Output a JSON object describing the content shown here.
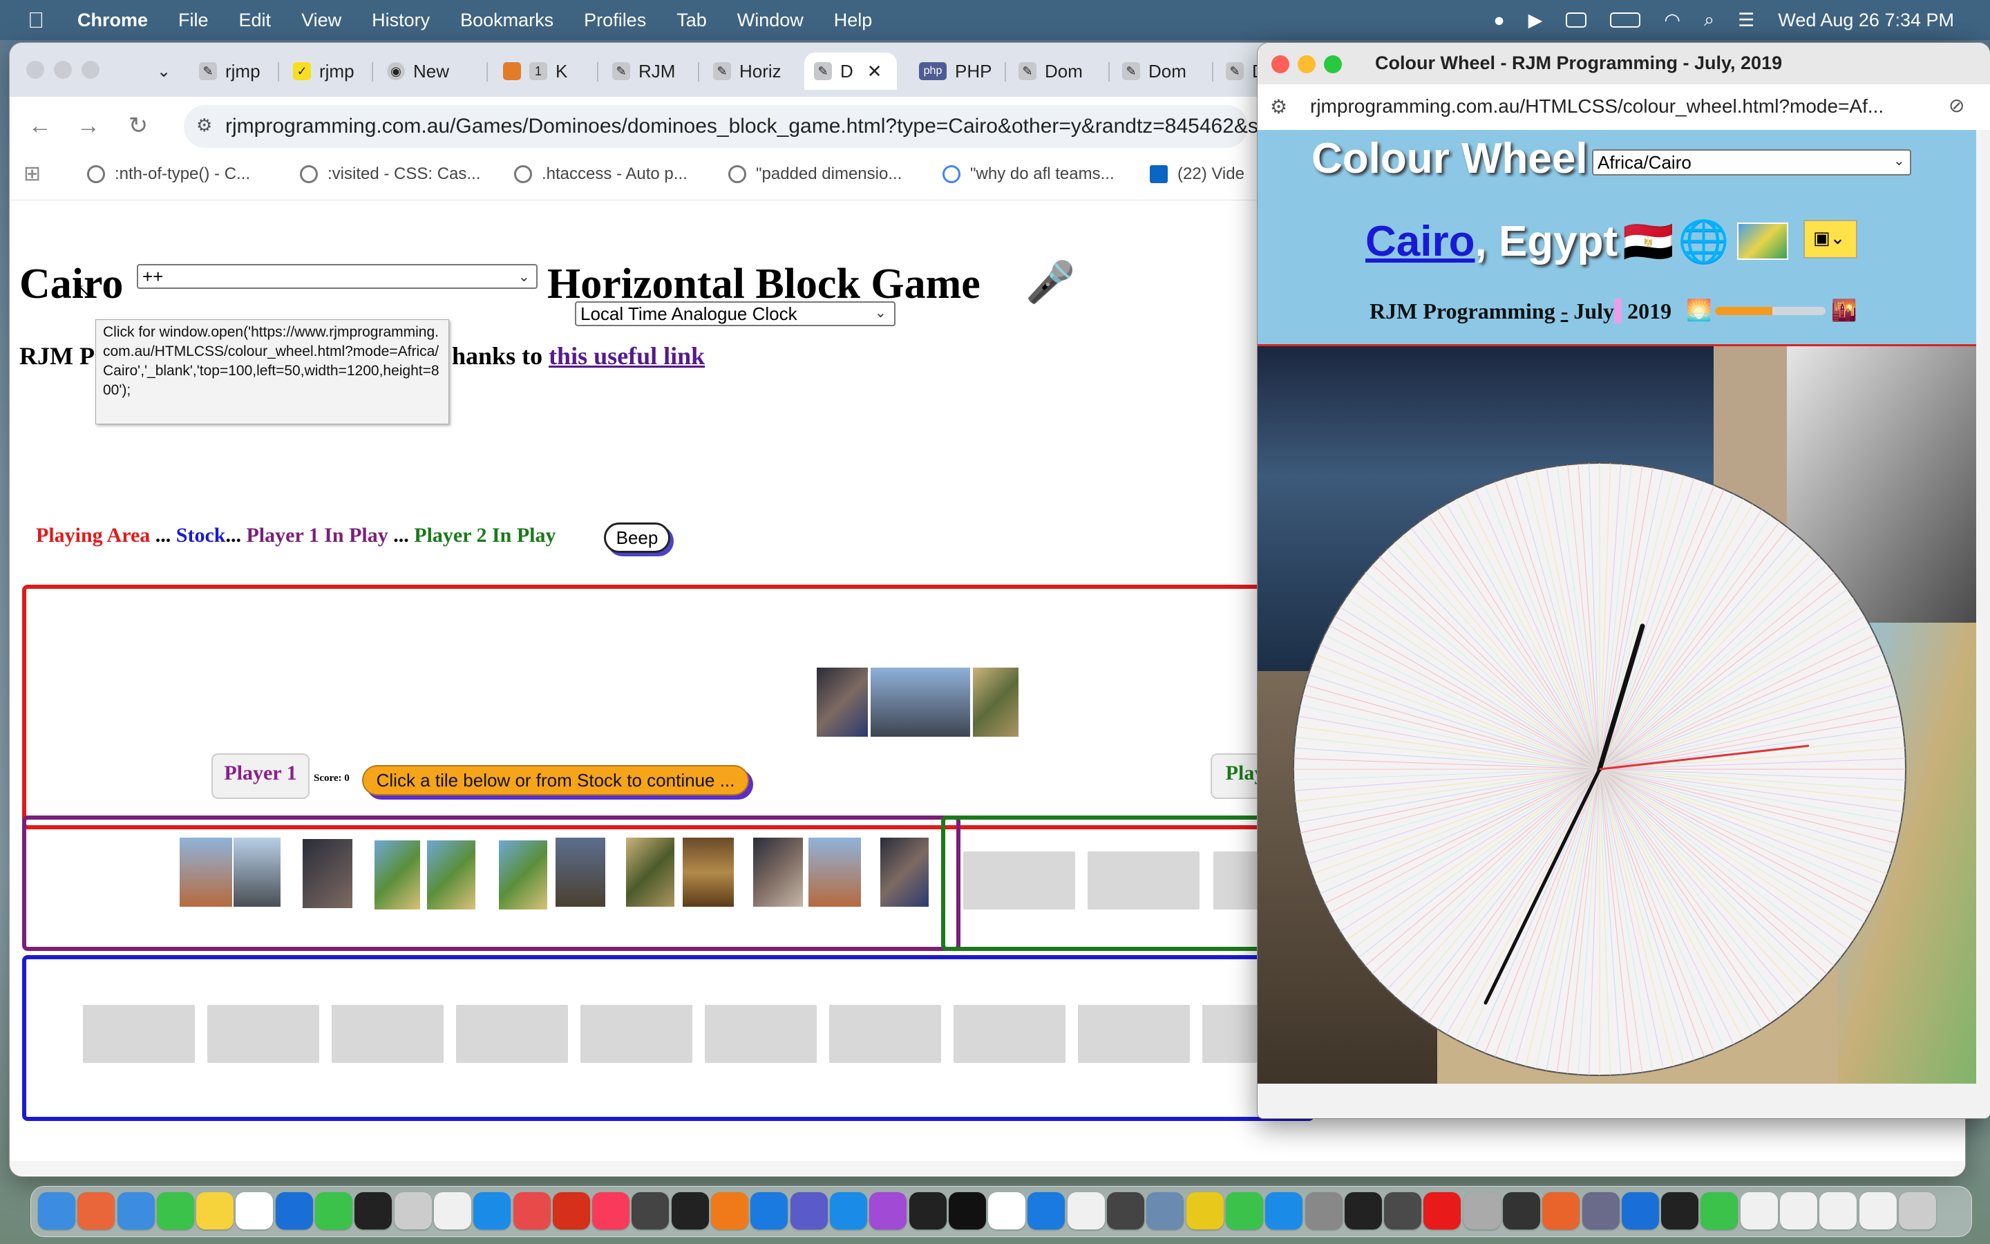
{
  "menubar": {
    "app": "Chrome",
    "items": [
      "File",
      "Edit",
      "View",
      "History",
      "Bookmarks",
      "Profiles",
      "Tab",
      "Window",
      "Help"
    ],
    "datetime": "Wed Aug 26  7:34 PM"
  },
  "browser": {
    "tabs": [
      "rjmp",
      "rjmp",
      "New",
      "K",
      "RJM",
      "Horiz",
      "D",
      "PHP",
      "Dom",
      "Dom",
      "D"
    ],
    "url": "rjmprogramming.com.au/Games/Dominoes/dominoes_block_game.html?type=Cairo&other=y&randtz=845462&se",
    "bookmarks": [
      ":nth-of-type() - C...",
      ":visited - CSS: Cas...",
      ".htaccess - Auto p...",
      "\"padded dimensio...",
      "\"why do afl teams...",
      "(22) Vide"
    ]
  },
  "page": {
    "city": "Cairo",
    "select_value": "++",
    "game_title": "Horizontal Block Game",
    "mic_icon": "🎤",
    "clock_select": "Local Time Analogue Clock",
    "credit_prefix": "RJM P",
    "credit_mid": "hanks to",
    "credit_link": "this useful link",
    "tooltip": "Click for window.open('https://www.rjmprogramming.com.au/HTMLCSS/colour_wheel.html?mode=Africa/Cairo','_blank','top=100,left=50,width=1200,height=800');",
    "legend": {
      "playing_area": "Playing Area",
      "sep1": "...",
      "stock": "Stock",
      "sep2": "...",
      "player1": "Player 1 In Play",
      "sep3": "...",
      "player2": "Player 2 In Play",
      "beep": "Beep"
    },
    "player1_button": "Player 1",
    "score_label": "Score: 0",
    "hint_button": "Click a tile below or from Stock to continue ...",
    "player2_button_partial": "Play"
  },
  "colour_wheel_window": {
    "title": "Colour Wheel - RJM Programming - July, 2019",
    "url": "rjmprogramming.com.au/HTMLCSS/colour_wheel.html?mode=Af...",
    "heading": "Colour Wheel",
    "timezone_select": "Africa/Cairo",
    "city_link": "Cairo",
    "country": ", Egypt",
    "flag": "🇪🇬",
    "globe": "🌐",
    "credit_a": "RJM Programming",
    "credit_dash": "-",
    "credit_b": "July",
    "credit_c": "2019",
    "sunrise_icon": "🌅",
    "sunset_icon": "🌇",
    "day_progress": 0.52
  },
  "colors": {
    "playing_area": "#e01a1a",
    "stock": "#1a1ad6",
    "player1": "#7a1f7a",
    "player2": "#1a7a1a",
    "menubar": "#3f6482",
    "hint_button": "#f6a41a"
  }
}
